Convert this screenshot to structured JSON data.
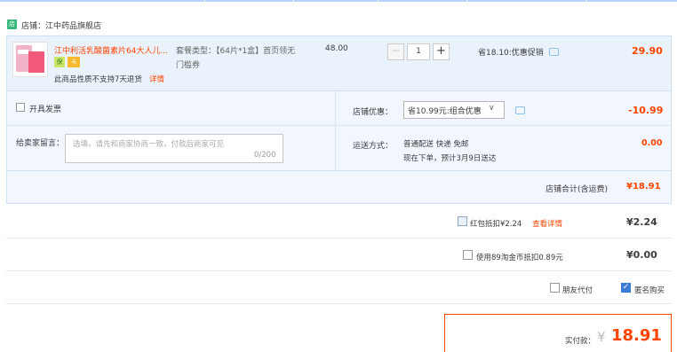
{
  "shop": {
    "icon": "shop-icon",
    "label": "店铺：江中药品旗舰店"
  },
  "item": {
    "title": "江中利活乳酸菌素片64大人儿...",
    "badges": [
      "保",
      "卡"
    ],
    "return_note": "此商品性质不支持7天退货",
    "detail_link": "详情",
    "sku": "套餐类型：【64片*1盒】首页领无门槛券",
    "unit_price": "48.00",
    "quantity": "1",
    "minus": "−",
    "plus": "+",
    "promo": "省18.10:优惠促销",
    "total": "29.90"
  },
  "invoice": {
    "label": "开具发票"
  },
  "message": {
    "label": "给卖家留言：",
    "placeholder": "选填，请先和商家协商一致，付款后商家可见",
    "count": "0/200"
  },
  "discount": {
    "label": "店铺优惠：",
    "value": "省10.99元:组合优惠",
    "chevron": "∨",
    "amount": "-10.99"
  },
  "shipping": {
    "label": "运送方式：",
    "line1": "普通配送 快递 免邮",
    "line2": "现在下单，预计3月9日送达",
    "amount": "0.00"
  },
  "subtotal": {
    "label": "店铺合计(含运费)",
    "value": "¥18.91"
  },
  "redpacket": {
    "label": "红包抵扣¥2.24",
    "link": "查看详情",
    "amount": "¥2.24",
    "checked": false
  },
  "taobao_coin": {
    "label": "使用89淘金币抵扣0.89元",
    "amount": "¥0.00",
    "checked": false
  },
  "friend_pay": {
    "label": "朋友代付",
    "checked": false
  },
  "anonymous": {
    "label": "匿名购买",
    "checked": true,
    "mark": "✓"
  },
  "payment": {
    "label": "实付款：",
    "currency": "¥",
    "value": "18.91"
  },
  "colors": {
    "accent": "#ff4400",
    "panel": "#f2f7ff",
    "border": "#cfe1f7"
  }
}
